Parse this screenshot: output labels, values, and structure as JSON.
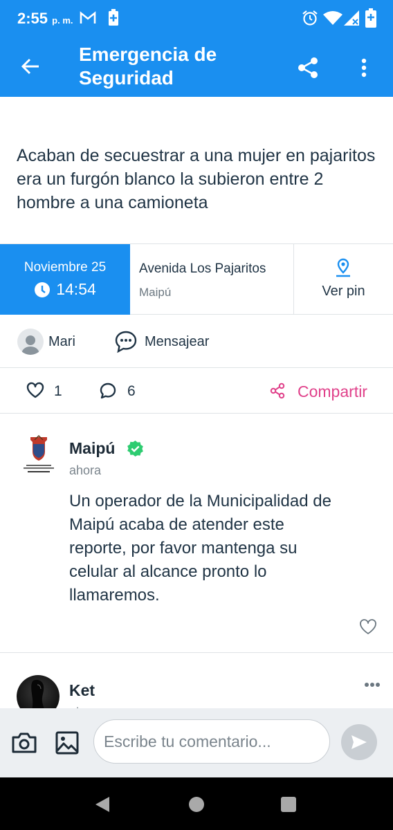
{
  "status_bar": {
    "time": "2:55",
    "ampm": "p. m.",
    "left_icons": [
      "gmail-icon",
      "battery-saver-icon"
    ],
    "right_icons": [
      "alarm-icon",
      "wifi-icon",
      "signal-icon",
      "battery-icon"
    ]
  },
  "app_bar": {
    "title": "Emergencia de Seguridad",
    "color": "#1a8ff0"
  },
  "report": {
    "text": "Acaban de secuestrar a una mujer en pajaritos era un furgón blanco la subieron entre 2 hombre a una camioneta"
  },
  "info": {
    "date": "Noviembre 25",
    "time": "14:54",
    "street": "Avenida Los Pajaritos",
    "city": "Maipú",
    "pin_label": "Ver pin"
  },
  "author": {
    "name": "Mari",
    "message_label": "Mensajear"
  },
  "stats": {
    "likes": "1",
    "comments": "6",
    "share_label": "Compartir",
    "share_color": "#e0408a"
  },
  "comments": [
    {
      "name": "Maipú",
      "time": "ahora",
      "text": "Un operador de la Municipalidad de Maipú acaba de atender este reporte, por favor mantenga su celular al alcance pronto lo llamaremos.",
      "logo_text": "ILUSTRE MUNICIPALIDAD DE MAIPU"
    },
    {
      "name": "Ket",
      "time": "ahora"
    }
  ],
  "comment_bar": {
    "placeholder": "Escribe tu comentario..."
  }
}
